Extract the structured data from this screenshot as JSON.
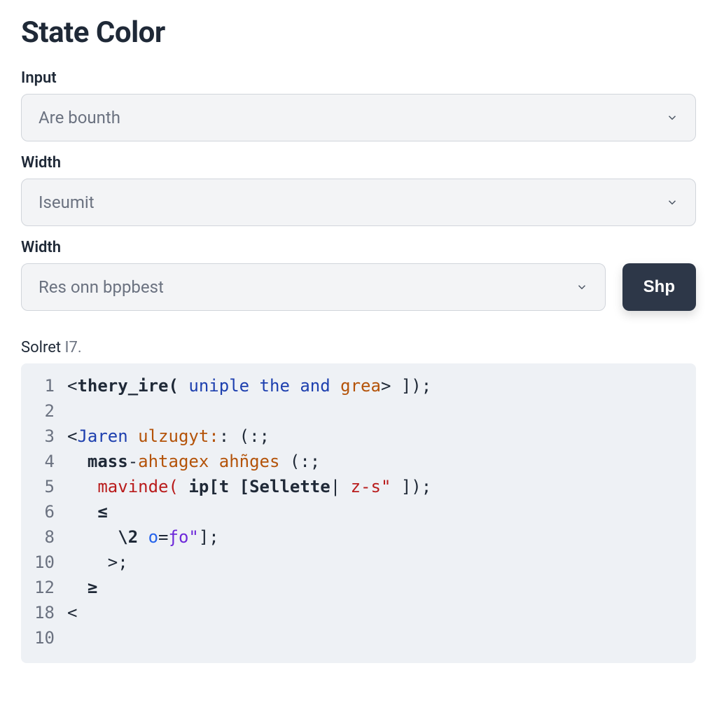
{
  "title": "State Color",
  "fields": {
    "input": {
      "label": "Input",
      "value": "Are bounth"
    },
    "width1": {
      "label": "Width",
      "value": "Iseumit"
    },
    "width2": {
      "label": "Width",
      "value": "Res onn bppbest"
    }
  },
  "action_button": "Shp",
  "caption": {
    "prefix": "Solret ",
    "suffix": "I7."
  },
  "code": {
    "lines": [
      {
        "n": "1",
        "tokens": [
          {
            "t": "<",
            "c": "tk-punc"
          },
          {
            "t": "thery_ire(",
            "c": "tk-kw"
          },
          {
            "t": " uniple the and ",
            "c": "tk-tag"
          },
          {
            "t": "grea",
            "c": "tk-attr"
          },
          {
            "t": ">",
            "c": "tk-punc"
          },
          {
            "t": " ]);",
            "c": "tk-punc"
          }
        ]
      },
      {
        "n": "2",
        "tokens": []
      },
      {
        "n": "3",
        "tokens": [
          {
            "t": "<",
            "c": "tk-punc"
          },
          {
            "t": "Jaren ",
            "c": "tk-tag"
          },
          {
            "t": "ulzugyt:",
            "c": "tk-attr"
          },
          {
            "t": ": (:;",
            "c": "tk-punc"
          }
        ]
      },
      {
        "n": "4",
        "tokens": [
          {
            "t": "  mass",
            "c": "tk-kw"
          },
          {
            "t": "-",
            "c": "tk-op"
          },
          {
            "t": "ahtagex ahñges",
            "c": "tk-attr"
          },
          {
            "t": " (:;",
            "c": "tk-punc"
          }
        ]
      },
      {
        "n": "5",
        "tokens": [
          {
            "t": "   ",
            "c": "tk-punc"
          },
          {
            "t": "mavinde(",
            "c": "tk-red"
          },
          {
            "t": " ip[t [Sellette",
            "c": "tk-kw"
          },
          {
            "t": "| ",
            "c": "tk-punc"
          },
          {
            "t": "z-s\"",
            "c": "tk-red"
          },
          {
            "t": " ]);",
            "c": "tk-punc"
          }
        ]
      },
      {
        "n": "6",
        "tokens": [
          {
            "t": "   ≤",
            "c": "tk-kw"
          }
        ]
      },
      {
        "n": "8",
        "tokens": [
          {
            "t": "     \\2 ",
            "c": "tk-kw"
          },
          {
            "t": "o",
            "c": "tk-num"
          },
          {
            "t": "=",
            "c": "tk-op"
          },
          {
            "t": "ƒo\"",
            "c": "tk-str"
          },
          {
            "t": "];",
            "c": "tk-punc"
          }
        ]
      },
      {
        "n": "10",
        "tokens": [
          {
            "t": "    >;",
            "c": "tk-punc"
          }
        ]
      },
      {
        "n": "12",
        "tokens": [
          {
            "t": "  ≥",
            "c": "tk-kw"
          }
        ]
      },
      {
        "n": "18",
        "tokens": [
          {
            "t": "<",
            "c": "tk-punc"
          }
        ]
      },
      {
        "n": "10",
        "tokens": []
      }
    ]
  }
}
